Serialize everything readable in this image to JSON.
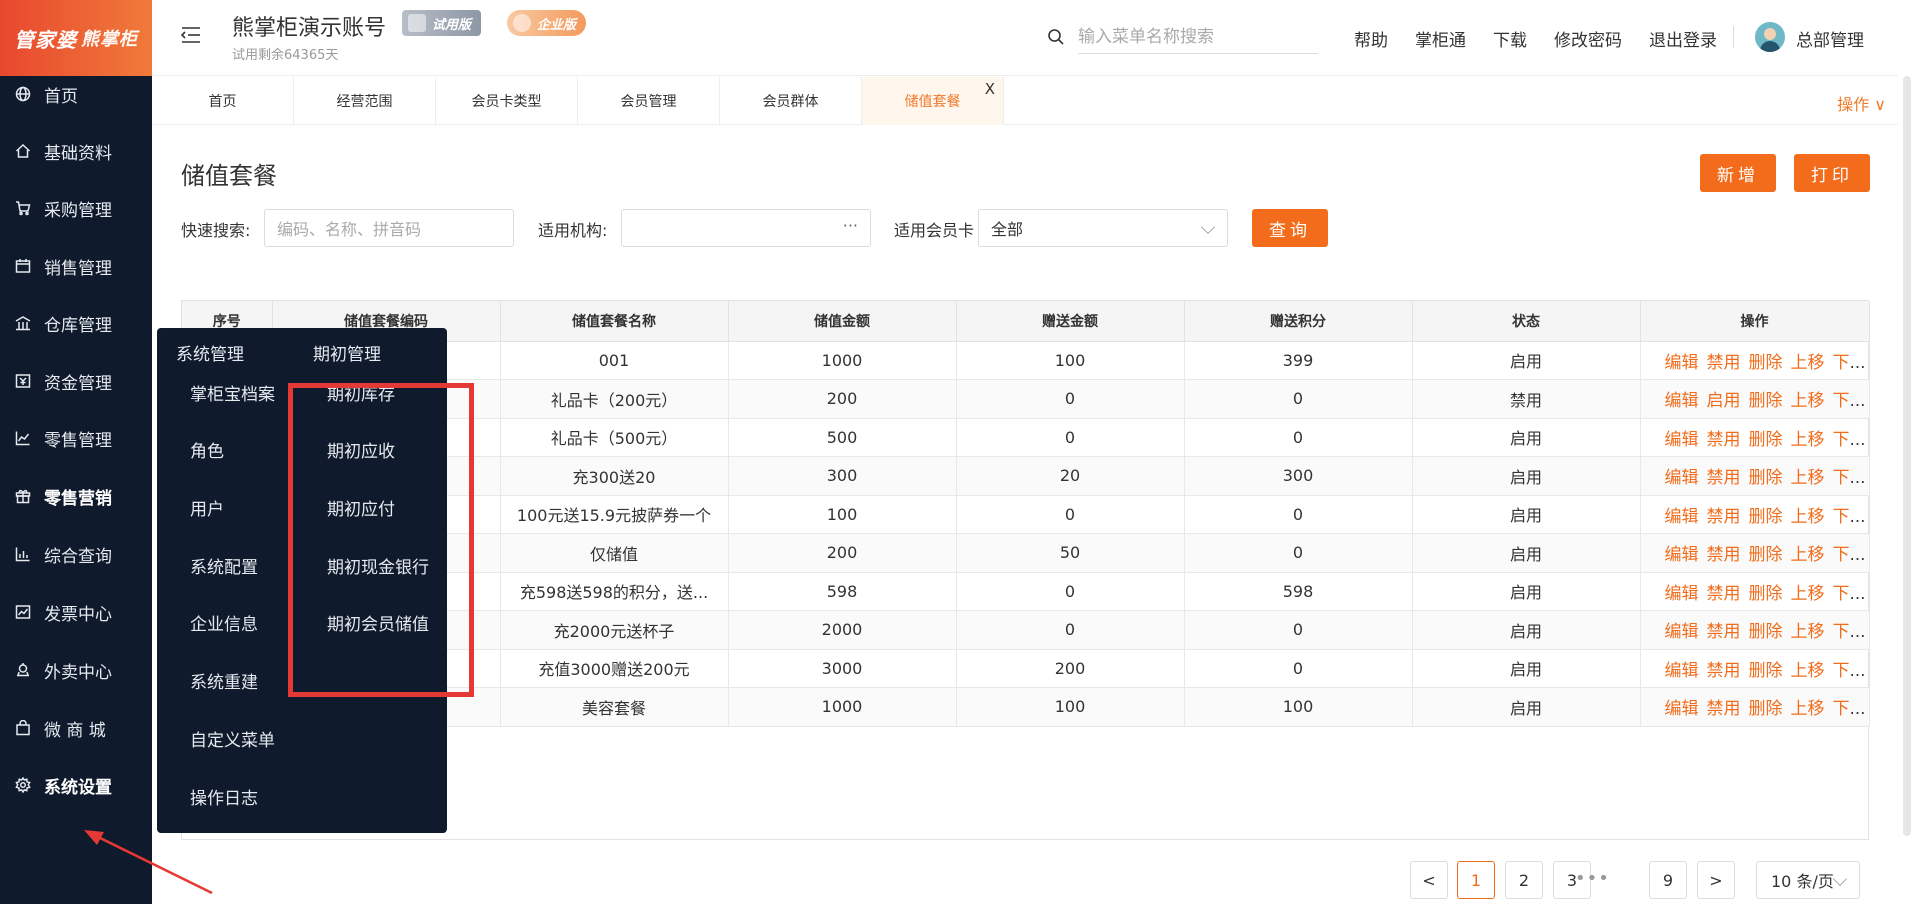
{
  "sidebar": {
    "logo_main": "管家婆",
    "logo_sub": "熊掌柜",
    "items": [
      {
        "label": "首页",
        "icon": "globe-icon"
      },
      {
        "label": "基础资料",
        "icon": "home-icon"
      },
      {
        "label": "采购管理",
        "icon": "cart-icon"
      },
      {
        "label": "销售管理",
        "icon": "calendar-icon"
      },
      {
        "label": "仓库管理",
        "icon": "warehouse-icon"
      },
      {
        "label": "资金管理",
        "icon": "money-icon"
      },
      {
        "label": "零售管理",
        "icon": "chart-icon"
      },
      {
        "label": "零售营销",
        "icon": "gift-icon"
      },
      {
        "label": "综合查询",
        "icon": "bar-chart-icon"
      },
      {
        "label": "发票中心",
        "icon": "trend-icon"
      },
      {
        "label": "外卖中心",
        "icon": "delivery-icon"
      },
      {
        "label": "微 商 城",
        "icon": "shop-bag-icon"
      },
      {
        "label": "系统设置",
        "icon": "gear-icon"
      }
    ]
  },
  "header": {
    "account_title": "熊掌柜演示账号",
    "trial_badge": "试用版",
    "enterprise_badge": "企业版",
    "trial_remaining": "试用剩余64365天",
    "search_placeholder": "输入菜单名称搜索",
    "links": [
      "帮助",
      "掌柜通",
      "下载",
      "修改密码",
      "退出登录"
    ],
    "user": "总部管理"
  },
  "tabs": {
    "items": [
      "首页",
      "经营范围",
      "会员卡类型",
      "会员管理",
      "会员群体",
      "储值套餐"
    ],
    "close": "X",
    "operations": "操作 ∨"
  },
  "page": {
    "title": "储值套餐",
    "add_button": "新增",
    "print_button": "打印",
    "query_button": "查询"
  },
  "filters": {
    "quick_search_label": "快速搜索:",
    "quick_search_placeholder": "编码、名称、拼音码",
    "org_label": "适用机构:",
    "org_more": "···",
    "card_label": "适用会员卡",
    "card_value": "全部"
  },
  "table": {
    "headers": [
      "序号",
      "储值套餐编码",
      "储值套餐名称",
      "储值金额",
      "赠送金额",
      "赠送积分",
      "状态",
      "操作"
    ],
    "rows": [
      {
        "name": "001",
        "amount": "1000",
        "gift": "100",
        "points": "399",
        "status": "启用",
        "toggle": "禁用"
      },
      {
        "name": "礼品卡（200元）",
        "amount": "200",
        "gift": "0",
        "points": "0",
        "status": "禁用",
        "toggle": "启用"
      },
      {
        "name": "礼品卡（500元）",
        "amount": "500",
        "gift": "0",
        "points": "0",
        "status": "启用",
        "toggle": "禁用"
      },
      {
        "name": "充300送20",
        "amount": "300",
        "gift": "20",
        "points": "300",
        "status": "启用",
        "toggle": "禁用"
      },
      {
        "name": "100元送15.9元披萨券一个",
        "amount": "100",
        "gift": "0",
        "points": "0",
        "status": "启用",
        "toggle": "禁用"
      },
      {
        "name": "仅储值",
        "amount": "200",
        "gift": "50",
        "points": "0",
        "status": "启用",
        "toggle": "禁用"
      },
      {
        "name": "充598送598的积分，送...",
        "amount": "598",
        "gift": "0",
        "points": "598",
        "status": "启用",
        "toggle": "禁用"
      },
      {
        "name": "充2000元送杯子",
        "amount": "2000",
        "gift": "0",
        "points": "0",
        "status": "启用",
        "toggle": "禁用"
      },
      {
        "name": "充值3000赠送200元",
        "amount": "3000",
        "gift": "200",
        "points": "0",
        "status": "启用",
        "toggle": "禁用"
      },
      {
        "name": "美容套餐",
        "amount": "1000",
        "gift": "100",
        "points": "100",
        "status": "启用",
        "toggle": "禁用"
      }
    ],
    "action_edit": "编辑",
    "action_delete": "删除",
    "action_up": "上移",
    "action_down": "下移"
  },
  "flyout": {
    "col1_title": "系统管理",
    "col2_title": "期初管理",
    "col1_items": [
      "掌柜宝档案",
      "角色",
      "用户",
      "系统配置",
      "企业信息",
      "系统重建",
      "自定义菜单",
      "操作日志"
    ],
    "col2_items": [
      "期初库存",
      "期初应收",
      "期初应付",
      "期初现金银行",
      "期初会员储值"
    ]
  },
  "pagination": {
    "prev": "<",
    "pages": [
      "1",
      "2",
      "3"
    ],
    "ellipsis": "•••",
    "last": "9",
    "next": ">",
    "page_size": "10 条/页"
  },
  "colors": {
    "accent": "#f26c1b",
    "sidebar_bg": "#0f1a2c",
    "highlight": "#e53935"
  }
}
